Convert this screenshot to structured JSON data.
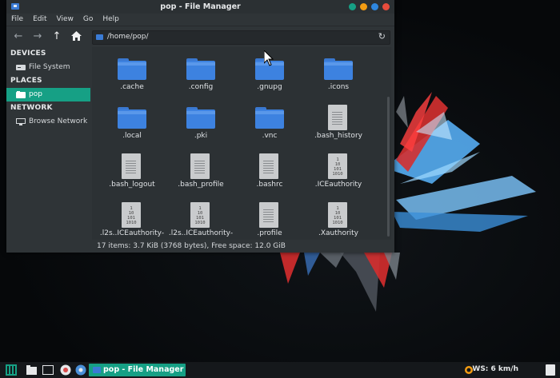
{
  "window": {
    "title": "pop - File Manager",
    "buttons": [
      {
        "name": "sticky-button",
        "color": "#16a085"
      },
      {
        "name": "minimize-button",
        "color": "#f39c12"
      },
      {
        "name": "maximize-button",
        "color": "#2e86de"
      },
      {
        "name": "close-button",
        "color": "#e74c3c"
      }
    ]
  },
  "menubar": [
    "File",
    "Edit",
    "View",
    "Go",
    "Help"
  ],
  "toolbar": {
    "path": "/home/pop/",
    "back_icon": "arrow-left-icon",
    "forward_icon": "arrow-right-icon",
    "up_icon": "arrow-up-icon",
    "home_icon": "home-icon",
    "reload_icon": "reload-icon"
  },
  "sidebar": {
    "devices_heading": "DEVICES",
    "devices": [
      {
        "label": "File System",
        "icon": "drive-icon"
      }
    ],
    "places_heading": "PLACES",
    "places": [
      {
        "label": "pop",
        "icon": "folder-icon",
        "active": true
      }
    ],
    "network_heading": "NETWORK",
    "network": [
      {
        "label": "Browse Network",
        "icon": "network-icon"
      }
    ]
  },
  "files": [
    {
      "name": ".cache",
      "type": "folder"
    },
    {
      "name": ".config",
      "type": "folder"
    },
    {
      "name": ".gnupg",
      "type": "folder"
    },
    {
      "name": ".icons",
      "type": "folder"
    },
    {
      "name": ".local",
      "type": "folder"
    },
    {
      "name": ".pki",
      "type": "folder"
    },
    {
      "name": ".vnc",
      "type": "folder"
    },
    {
      "name": ".bash_history",
      "type": "text"
    },
    {
      "name": ".bash_logout",
      "type": "text"
    },
    {
      "name": ".bash_profile",
      "type": "text"
    },
    {
      "name": ".bashrc",
      "type": "text"
    },
    {
      "name": ".ICEauthority",
      "type": "binary"
    },
    {
      "name": ".l2s..ICEauthority-",
      "type": "binary"
    },
    {
      "name": ".l2s..ICEauthority-",
      "type": "binary"
    },
    {
      "name": ".profile",
      "type": "text"
    },
    {
      "name": ".Xauthority",
      "type": "binary"
    }
  ],
  "binary_glyph": "1\n10\n101\n1010",
  "status": "17 items: 3.7 KiB (3768 bytes), Free space: 12.0 GiB",
  "taskbar": {
    "task_label": "pop - File Manager",
    "weather": "WS: 6 km/h",
    "accent": "#16a085"
  }
}
